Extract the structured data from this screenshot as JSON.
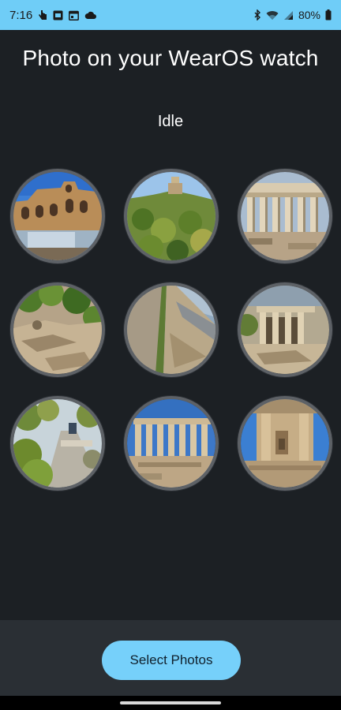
{
  "status_bar": {
    "time": "7:16",
    "battery": "80%",
    "icons": [
      "hand-icon",
      "sd-card-icon",
      "calendar-icon",
      "cloud-icon",
      "bluetooth-icon",
      "wifi-icon",
      "signal-icon",
      "battery-icon"
    ]
  },
  "header": {
    "title": "Photo on your WearOS watch",
    "state": "Idle"
  },
  "photos": [
    {
      "subject": "odeon-theatre"
    },
    {
      "subject": "hill-chapel"
    },
    {
      "subject": "parthenon-columns"
    },
    {
      "subject": "rocky-hillside"
    },
    {
      "subject": "cliff-path"
    },
    {
      "subject": "propylaea"
    },
    {
      "subject": "garden-path"
    },
    {
      "subject": "parthenon-front"
    },
    {
      "subject": "erechtheion-porch"
    }
  ],
  "footer": {
    "select_label": "Select Photos"
  },
  "colors": {
    "accent": "#76d0fa",
    "status_bar": "#6fcdf7",
    "background": "#1c2024"
  }
}
